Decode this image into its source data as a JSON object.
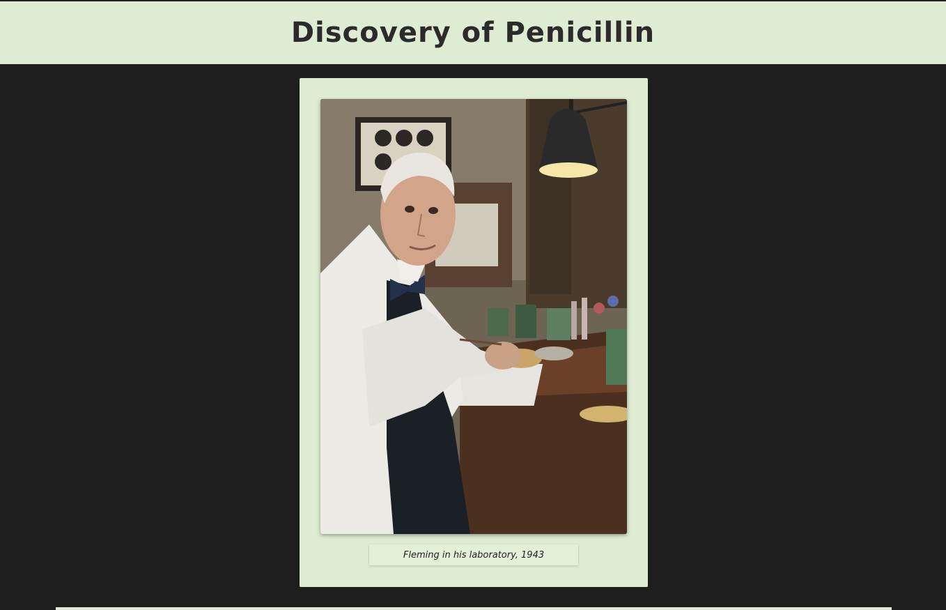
{
  "page": {
    "title": "Discovery of Penicillin"
  },
  "figure": {
    "image_icon": "portrait-photo-icon",
    "caption": "Fleming in his laboratory, 1943"
  },
  "colors": {
    "background": "#1e1e1e",
    "panel": "#deecd4",
    "title_text": "#2b2b2b"
  }
}
